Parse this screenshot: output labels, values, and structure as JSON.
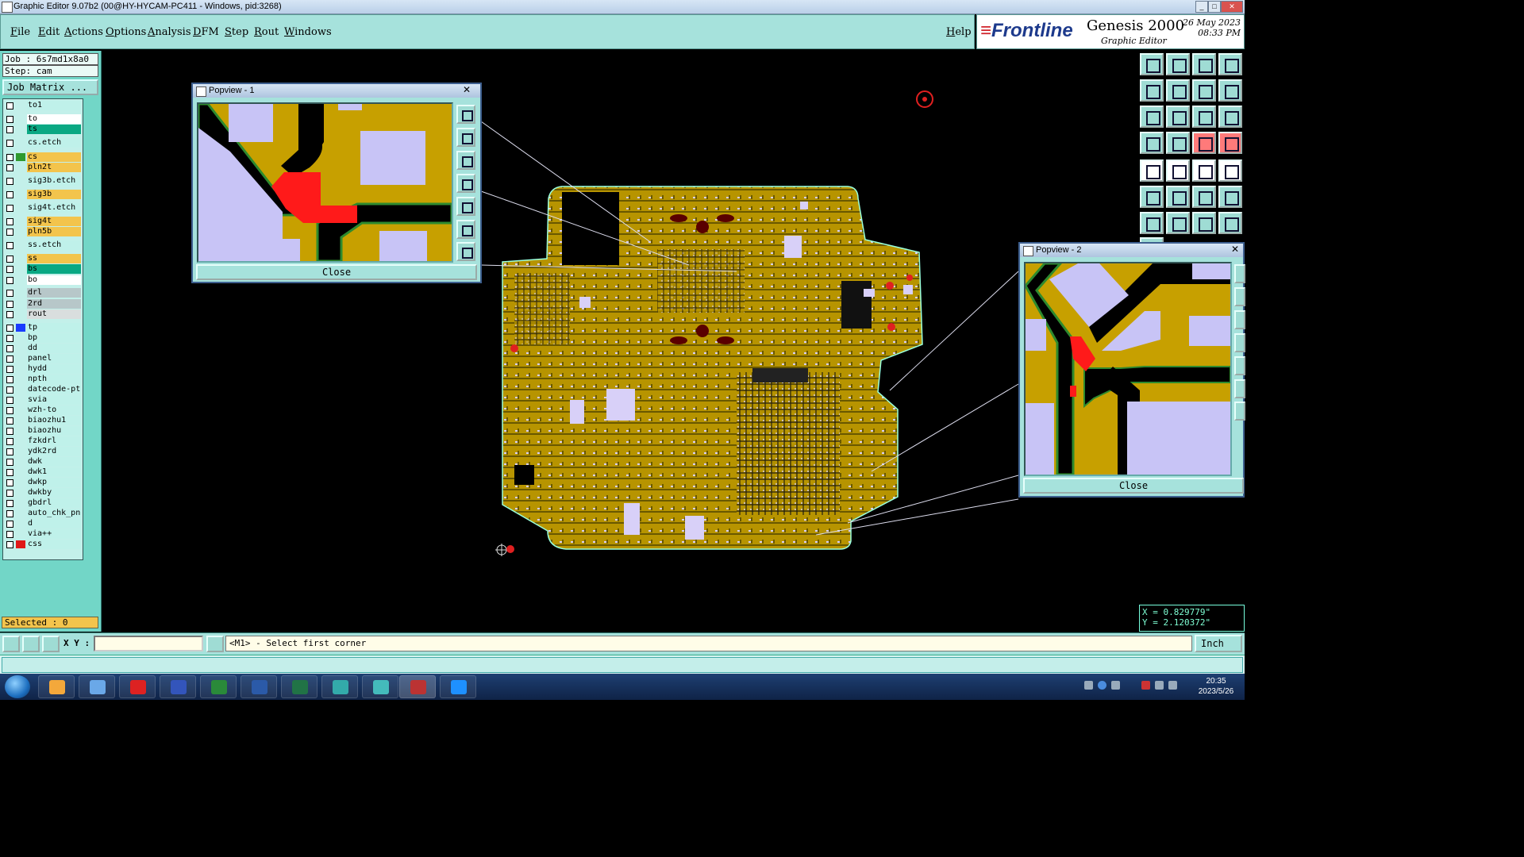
{
  "window": {
    "title": "Graphic Editor 9.07b2 (00@HY-HYCAM-PC411 - Windows, pid:3268)",
    "minimize": "_",
    "maximize": "□",
    "close": "✕"
  },
  "menu": {
    "items": [
      "File",
      "Edit",
      "Actions",
      "Options",
      "Analysis",
      "DFM",
      "Step",
      "Rout",
      "Windows"
    ],
    "help": "Help"
  },
  "brand": {
    "logo": "Frontline",
    "product": "Genesis 2000",
    "subtitle": "Graphic Editor",
    "date": "26 May 2023",
    "time": "08:33 PM"
  },
  "job": {
    "job": "Job : 6s7md1x8a0",
    "step": "Step: cam",
    "matrix_button": "Job Matrix ...",
    "selected": "Selected : 0"
  },
  "layers": [
    {
      "name": "to1",
      "bg": "#bff1ea",
      "sw": ""
    },
    {
      "name": "to",
      "bg": "#ffffff",
      "sw": ""
    },
    {
      "name": "ts",
      "bg": "#0aa883",
      "sw": ""
    },
    {
      "name": "cs.etch",
      "bg": "#bff1ea",
      "sw": ""
    },
    {
      "name": "cs",
      "bg": "#f3c44c",
      "sw": "#2e9a2e"
    },
    {
      "name": "pln2t",
      "bg": "#f3c44c",
      "sw": ""
    },
    {
      "name": "sig3b.etch",
      "bg": "#bff1ea",
      "sw": ""
    },
    {
      "name": "sig3b",
      "bg": "#f3c44c",
      "sw": ""
    },
    {
      "name": "sig4t.etch",
      "bg": "#bff1ea",
      "sw": ""
    },
    {
      "name": "sig4t",
      "bg": "#f3c44c",
      "sw": ""
    },
    {
      "name": "pln5b",
      "bg": "#f3c44c",
      "sw": ""
    },
    {
      "name": "ss.etch",
      "bg": "#bff1ea",
      "sw": ""
    },
    {
      "name": "ss",
      "bg": "#f3c44c",
      "sw": ""
    },
    {
      "name": "bs",
      "bg": "#0aa883",
      "sw": ""
    },
    {
      "name": "bo",
      "bg": "#ffffff",
      "sw": ""
    },
    {
      "name": "drl",
      "bg": "#b7c7c9",
      "sw": ""
    },
    {
      "name": "2rd",
      "bg": "#b7c7c9",
      "sw": ""
    },
    {
      "name": "rout",
      "bg": "#d9dede",
      "sw": ""
    },
    {
      "name": "tp",
      "bg": "#bff1ea",
      "sw": "#1a3cff"
    },
    {
      "name": "bp",
      "bg": "#bff1ea",
      "sw": ""
    },
    {
      "name": "dd",
      "bg": "#bff1ea",
      "sw": ""
    },
    {
      "name": "panel",
      "bg": "#bff1ea",
      "sw": ""
    },
    {
      "name": "hydd",
      "bg": "#bff1ea",
      "sw": ""
    },
    {
      "name": "npth",
      "bg": "#bff1ea",
      "sw": ""
    },
    {
      "name": "datecode-pt",
      "bg": "#bff1ea",
      "sw": ""
    },
    {
      "name": "svia",
      "bg": "#bff1ea",
      "sw": ""
    },
    {
      "name": "wzh-to",
      "bg": "#bff1ea",
      "sw": ""
    },
    {
      "name": "biaozhu1",
      "bg": "#bff1ea",
      "sw": ""
    },
    {
      "name": "biaozhu",
      "bg": "#bff1ea",
      "sw": ""
    },
    {
      "name": "fzkdrl",
      "bg": "#bff1ea",
      "sw": ""
    },
    {
      "name": "ydk2rd",
      "bg": "#bff1ea",
      "sw": ""
    },
    {
      "name": "dwk",
      "bg": "#bff1ea",
      "sw": ""
    },
    {
      "name": "dwk1",
      "bg": "#bff1ea",
      "sw": ""
    },
    {
      "name": "dwkp",
      "bg": "#bff1ea",
      "sw": ""
    },
    {
      "name": "dwkby",
      "bg": "#bff1ea",
      "sw": ""
    },
    {
      "name": "gbdrl",
      "bg": "#bff1ea",
      "sw": ""
    },
    {
      "name": "auto_chk_pn",
      "bg": "#bff1ea",
      "sw": ""
    },
    {
      "name": "d",
      "bg": "#bff1ea",
      "sw": ""
    },
    {
      "name": "via++",
      "bg": "#bff1ea",
      "sw": ""
    },
    {
      "name": "css",
      "bg": "#bff1ea",
      "sw": "#e01818"
    }
  ],
  "popup1": {
    "title": "Popview - 1",
    "close_x": "✕",
    "close_button": "Close"
  },
  "popup2": {
    "title": "Popview - 2",
    "close_x": "✕",
    "close_button": "Close"
  },
  "coords": {
    "x": "X = 0.829779\"",
    "y": "Y = 2.120372\""
  },
  "bottom": {
    "xy_label": "X Y :",
    "xy_value": "",
    "status": "<M1> - Select first corner",
    "units": "Inch"
  },
  "taskbar": {
    "time": "20:35",
    "date": "2023/5/26"
  },
  "colors": {
    "copper": "#c7a000",
    "pad": "#c8c4f6",
    "trace_outline": "#2e8a2e",
    "highlight": "#ff1a1a",
    "panel": "#a6e2dc",
    "canvas": "#000000"
  }
}
